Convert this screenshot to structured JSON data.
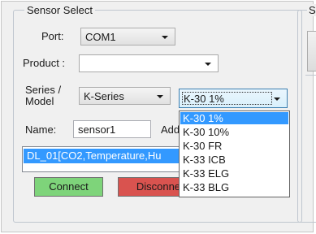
{
  "group": {
    "title": "Sensor Select"
  },
  "right_group": {
    "title_fragment": "S"
  },
  "port": {
    "label": "Port:",
    "value": "COM1"
  },
  "product": {
    "label": "Product :",
    "value": ""
  },
  "series": {
    "label_line1": "Series /",
    "label_line2": "Model",
    "series_value": "K-Series",
    "model_value": "K-30 1%"
  },
  "name": {
    "label": "Name:",
    "value": "sensor1",
    "next_label_fragment": "Add"
  },
  "device_list": {
    "selected_item": "DL_01[CO2,Temperature,Hu"
  },
  "buttons": {
    "connect": "Connect",
    "disconnect": "Disconnect"
  },
  "model_dropdown": {
    "options": [
      "K-30 1%",
      "K-30 10%",
      "K-30 FR",
      "K-33 ICB",
      "K-33 ELG",
      "K-33 BLG"
    ],
    "selected_index": 0
  },
  "colors": {
    "selection": "#3399ff",
    "connect": "#7ed47a",
    "disconnect": "#d9534f"
  }
}
